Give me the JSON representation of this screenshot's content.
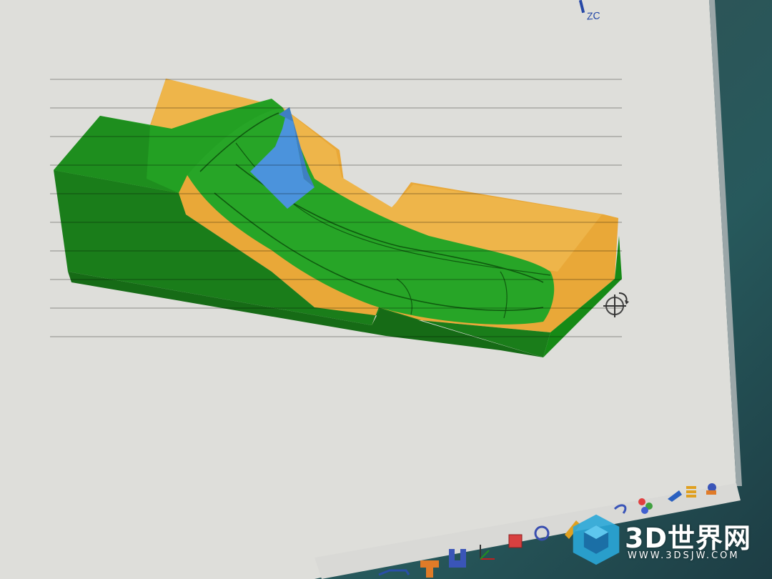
{
  "viewport": {
    "axis_label": "ZC",
    "background_color": "#dcdcd7",
    "model": {
      "name": "mold-part-3d-model",
      "face_colors": {
        "primary": "#1f9c1f",
        "secondary": "#e8a93a",
        "highlight": "#4a90d9"
      }
    }
  },
  "toolbar": {
    "icons": [
      "sketch-icon",
      "extrude-icon",
      "pocket-icon",
      "coordinate-system-icon",
      "box-icon",
      "circle-icon",
      "fillet-icon",
      "measure-icon",
      "assembly-icon",
      "bend-icon",
      "layer-icon",
      "settings-icon"
    ]
  },
  "watermark": {
    "brand": "3D世界网",
    "url": "WWW.3DSJW.COM",
    "logo_color": "#2aa7d8"
  }
}
